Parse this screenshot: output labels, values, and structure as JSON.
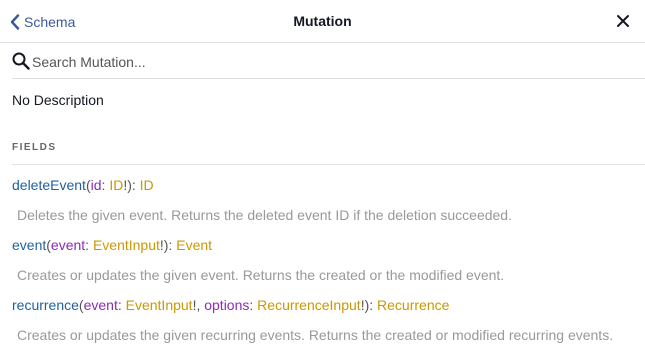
{
  "header": {
    "back_label": "Schema",
    "title": "Mutation",
    "close_icon": "close-icon"
  },
  "search": {
    "placeholder": "Search Mutation...",
    "value": ""
  },
  "description": "No Description",
  "fields_section": {
    "title": "FIELDS",
    "fields": [
      {
        "name": "deleteEvent",
        "args": [
          {
            "name": "id",
            "type": "ID"
          }
        ],
        "return_type": "ID",
        "description": "Deletes the given event. Returns the deleted event ID if the deletion succeeded."
      },
      {
        "name": "event",
        "args": [
          {
            "name": "event",
            "type": "EventInput"
          }
        ],
        "return_type": "Event",
        "description": "Creates or updates the given event. Returns the created or the modified event."
      },
      {
        "name": "recurrence",
        "args": [
          {
            "name": "event",
            "type": "EventInput"
          },
          {
            "name": "options",
            "type": "RecurrenceInput"
          }
        ],
        "return_type": "Recurrence",
        "description": "Creates or updates the given recurring events. Returns the created or modified recurring events."
      }
    ]
  },
  "colors": {
    "field_name": "#1f61a0",
    "arg_name": "#8b2bb9",
    "type_name": "#ca9800",
    "description": "#999999"
  }
}
